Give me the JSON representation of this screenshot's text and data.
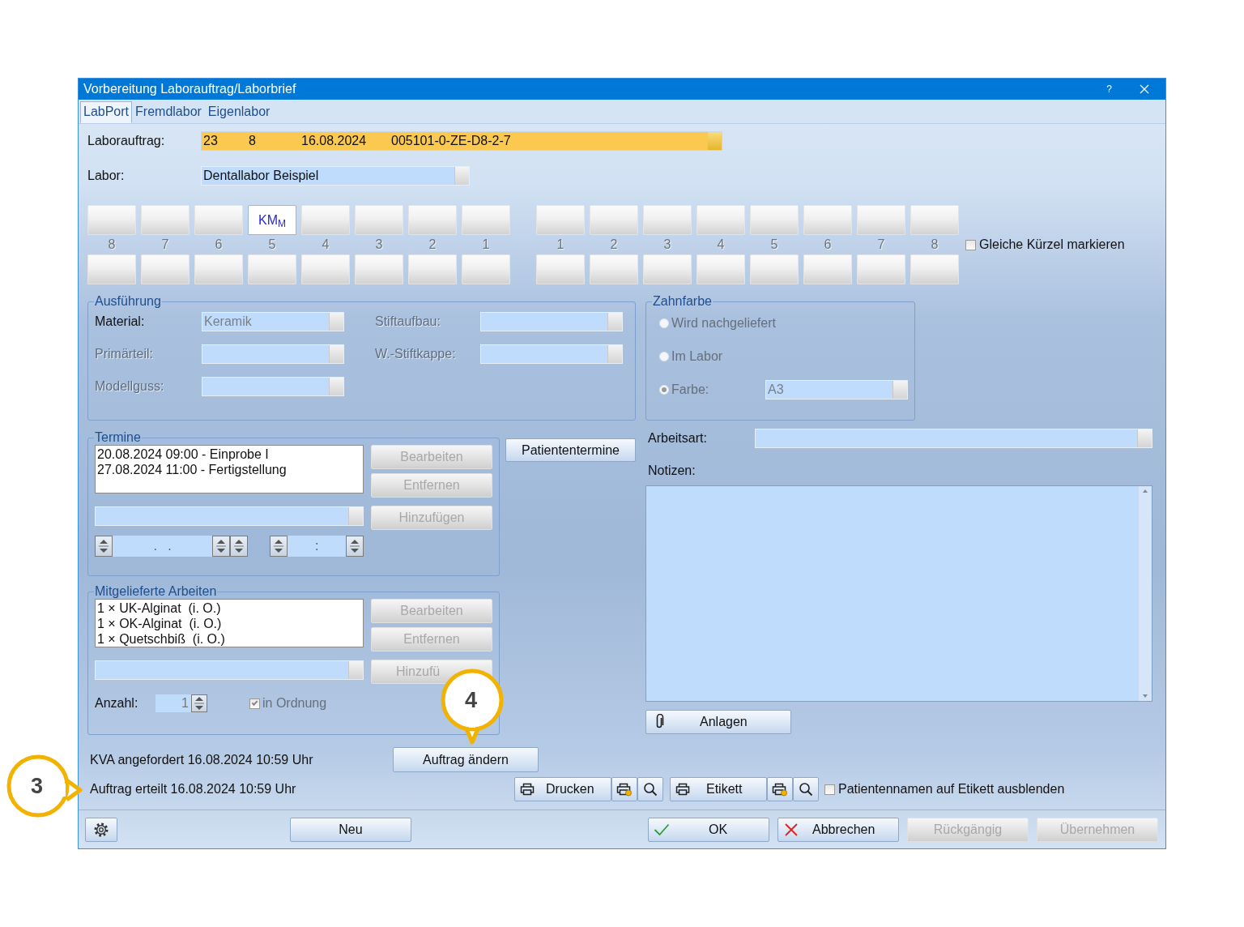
{
  "window": {
    "title": "Vorbereitung Laborauftrag/Laborbrief",
    "help": "?"
  },
  "tabs": [
    {
      "label": "LabPort",
      "selected": true
    },
    {
      "label": "Fremdlabor",
      "selected": false
    },
    {
      "label": "Eigenlabor",
      "selected": false
    }
  ],
  "laborauftrag": {
    "label": "Laborauftrag:",
    "values": [
      "23",
      "8",
      "16.08.2024",
      "005101-0-ZE-D8-2-7"
    ]
  },
  "labor": {
    "label": "Labor:",
    "value": "Dentallabor Beispiel"
  },
  "teeth": {
    "upper": [
      {
        "marked": false
      },
      {
        "marked": false
      },
      {
        "marked": false
      },
      {
        "marked": true,
        "label": "KM$_{M}$"
      },
      {
        "marked": false
      },
      {
        "marked": false
      },
      {
        "marked": false
      },
      {
        "marked": false
      },
      {
        "marked": false
      },
      {
        "marked": false
      },
      {
        "marked": false
      },
      {
        "marked": false
      },
      {
        "marked": false
      },
      {
        "marked": false
      },
      {
        "marked": false
      },
      {
        "marked": false
      }
    ],
    "numbers": [
      "8",
      "7",
      "6",
      "5",
      "4",
      "3",
      "2",
      "1",
      "1",
      "2",
      "3",
      "4",
      "5",
      "6",
      "7",
      "8"
    ],
    "lower": [
      {
        "marked": false
      },
      {
        "marked": false
      },
      {
        "marked": false
      },
      {
        "marked": false
      },
      {
        "marked": false
      },
      {
        "marked": false
      },
      {
        "marked": false
      },
      {
        "marked": false
      },
      {
        "marked": false
      },
      {
        "marked": false
      },
      {
        "marked": false
      },
      {
        "marked": false
      },
      {
        "marked": false
      },
      {
        "marked": false
      },
      {
        "marked": false
      },
      {
        "marked": false
      }
    ],
    "same_marks": {
      "label": "Gleiche Kürzel markieren",
      "checked": false
    }
  },
  "ausfuehrung": {
    "title": "Ausführung",
    "fields": [
      {
        "label": "Material:",
        "disabled": false,
        "value": "Keramik"
      },
      {
        "label": "Stiftaufbau:",
        "disabled": true
      },
      {
        "label": "Primärteil:",
        "disabled": true
      },
      {
        "label": "W.-Stiftkappe:",
        "disabled": true
      },
      {
        "label": "Modellguss:",
        "disabled": true
      }
    ]
  },
  "zahnfarbe": {
    "title": "Zahnfarbe",
    "options": [
      {
        "label": "Wird nachgeliefert",
        "selected": false,
        "disabled": true
      },
      {
        "label": "Im Labor",
        "selected": false,
        "disabled": true
      },
      {
        "label": "Farbe:",
        "selected": true,
        "disabled": true
      }
    ],
    "color_value": "A3"
  },
  "termine": {
    "title": "Termine",
    "items": [
      "20.08.2024 09:00 - Einprobe I",
      "27.08.2024 11:00 - Fertigstellung"
    ],
    "buttons": [
      {
        "label": "Bearbeiten",
        "disabled": true
      },
      {
        "label": "Entfernen",
        "disabled": true
      },
      {
        "label": "Hinzufügen",
        "disabled": true
      }
    ],
    "date_mask": ".   .",
    "time_mask": ":"
  },
  "patiententermine": "Patiententermine",
  "arbeitsart": {
    "label": "Arbeitsart:"
  },
  "notizen": {
    "label": "Notizen:"
  },
  "anlagen": "Anlagen",
  "mitgeliefert": {
    "title": "Mitgelieferte Arbeiten",
    "items": [
      "1 × UK-Alginat  (i. O.)",
      "1 × OK-Alginat  (i. O.)",
      "1 × Quetschbiß  (i. O.)"
    ],
    "buttons": [
      {
        "label": "Bearbeiten",
        "disabled": true
      },
      {
        "label": "Entfernen",
        "disabled": true
      },
      {
        "label": "Hinzufü",
        "disabled": true
      }
    ],
    "count_label": "Anzahl:",
    "count": "1",
    "in_order": {
      "label": "in Ordnung",
      "checked": true,
      "disabled": true
    }
  },
  "status": [
    "KVA angefordert 16.08.2024 10:59 Uhr",
    "Auftrag erteilt 16.08.2024 10:59 Uhr"
  ],
  "auftrag_aendern": "Auftrag ändern",
  "print": {
    "drucken": "Drucken",
    "etikett": "Etikett",
    "hide_names": {
      "label": "Patientennamen auf Etikett ausblenden",
      "checked": false
    }
  },
  "footer": [
    {
      "label": "Neu",
      "kind": "plain",
      "disabled": false
    },
    {
      "label": "OK",
      "kind": "ok",
      "disabled": false
    },
    {
      "label": "Abbrechen",
      "kind": "cancel",
      "disabled": false
    },
    {
      "label": "Rückgängig",
      "kind": "plain",
      "disabled": true
    },
    {
      "label": "Übernehmen",
      "kind": "plain",
      "disabled": true
    }
  ],
  "callouts": [
    {
      "label": "3"
    },
    {
      "label": "4"
    }
  ]
}
